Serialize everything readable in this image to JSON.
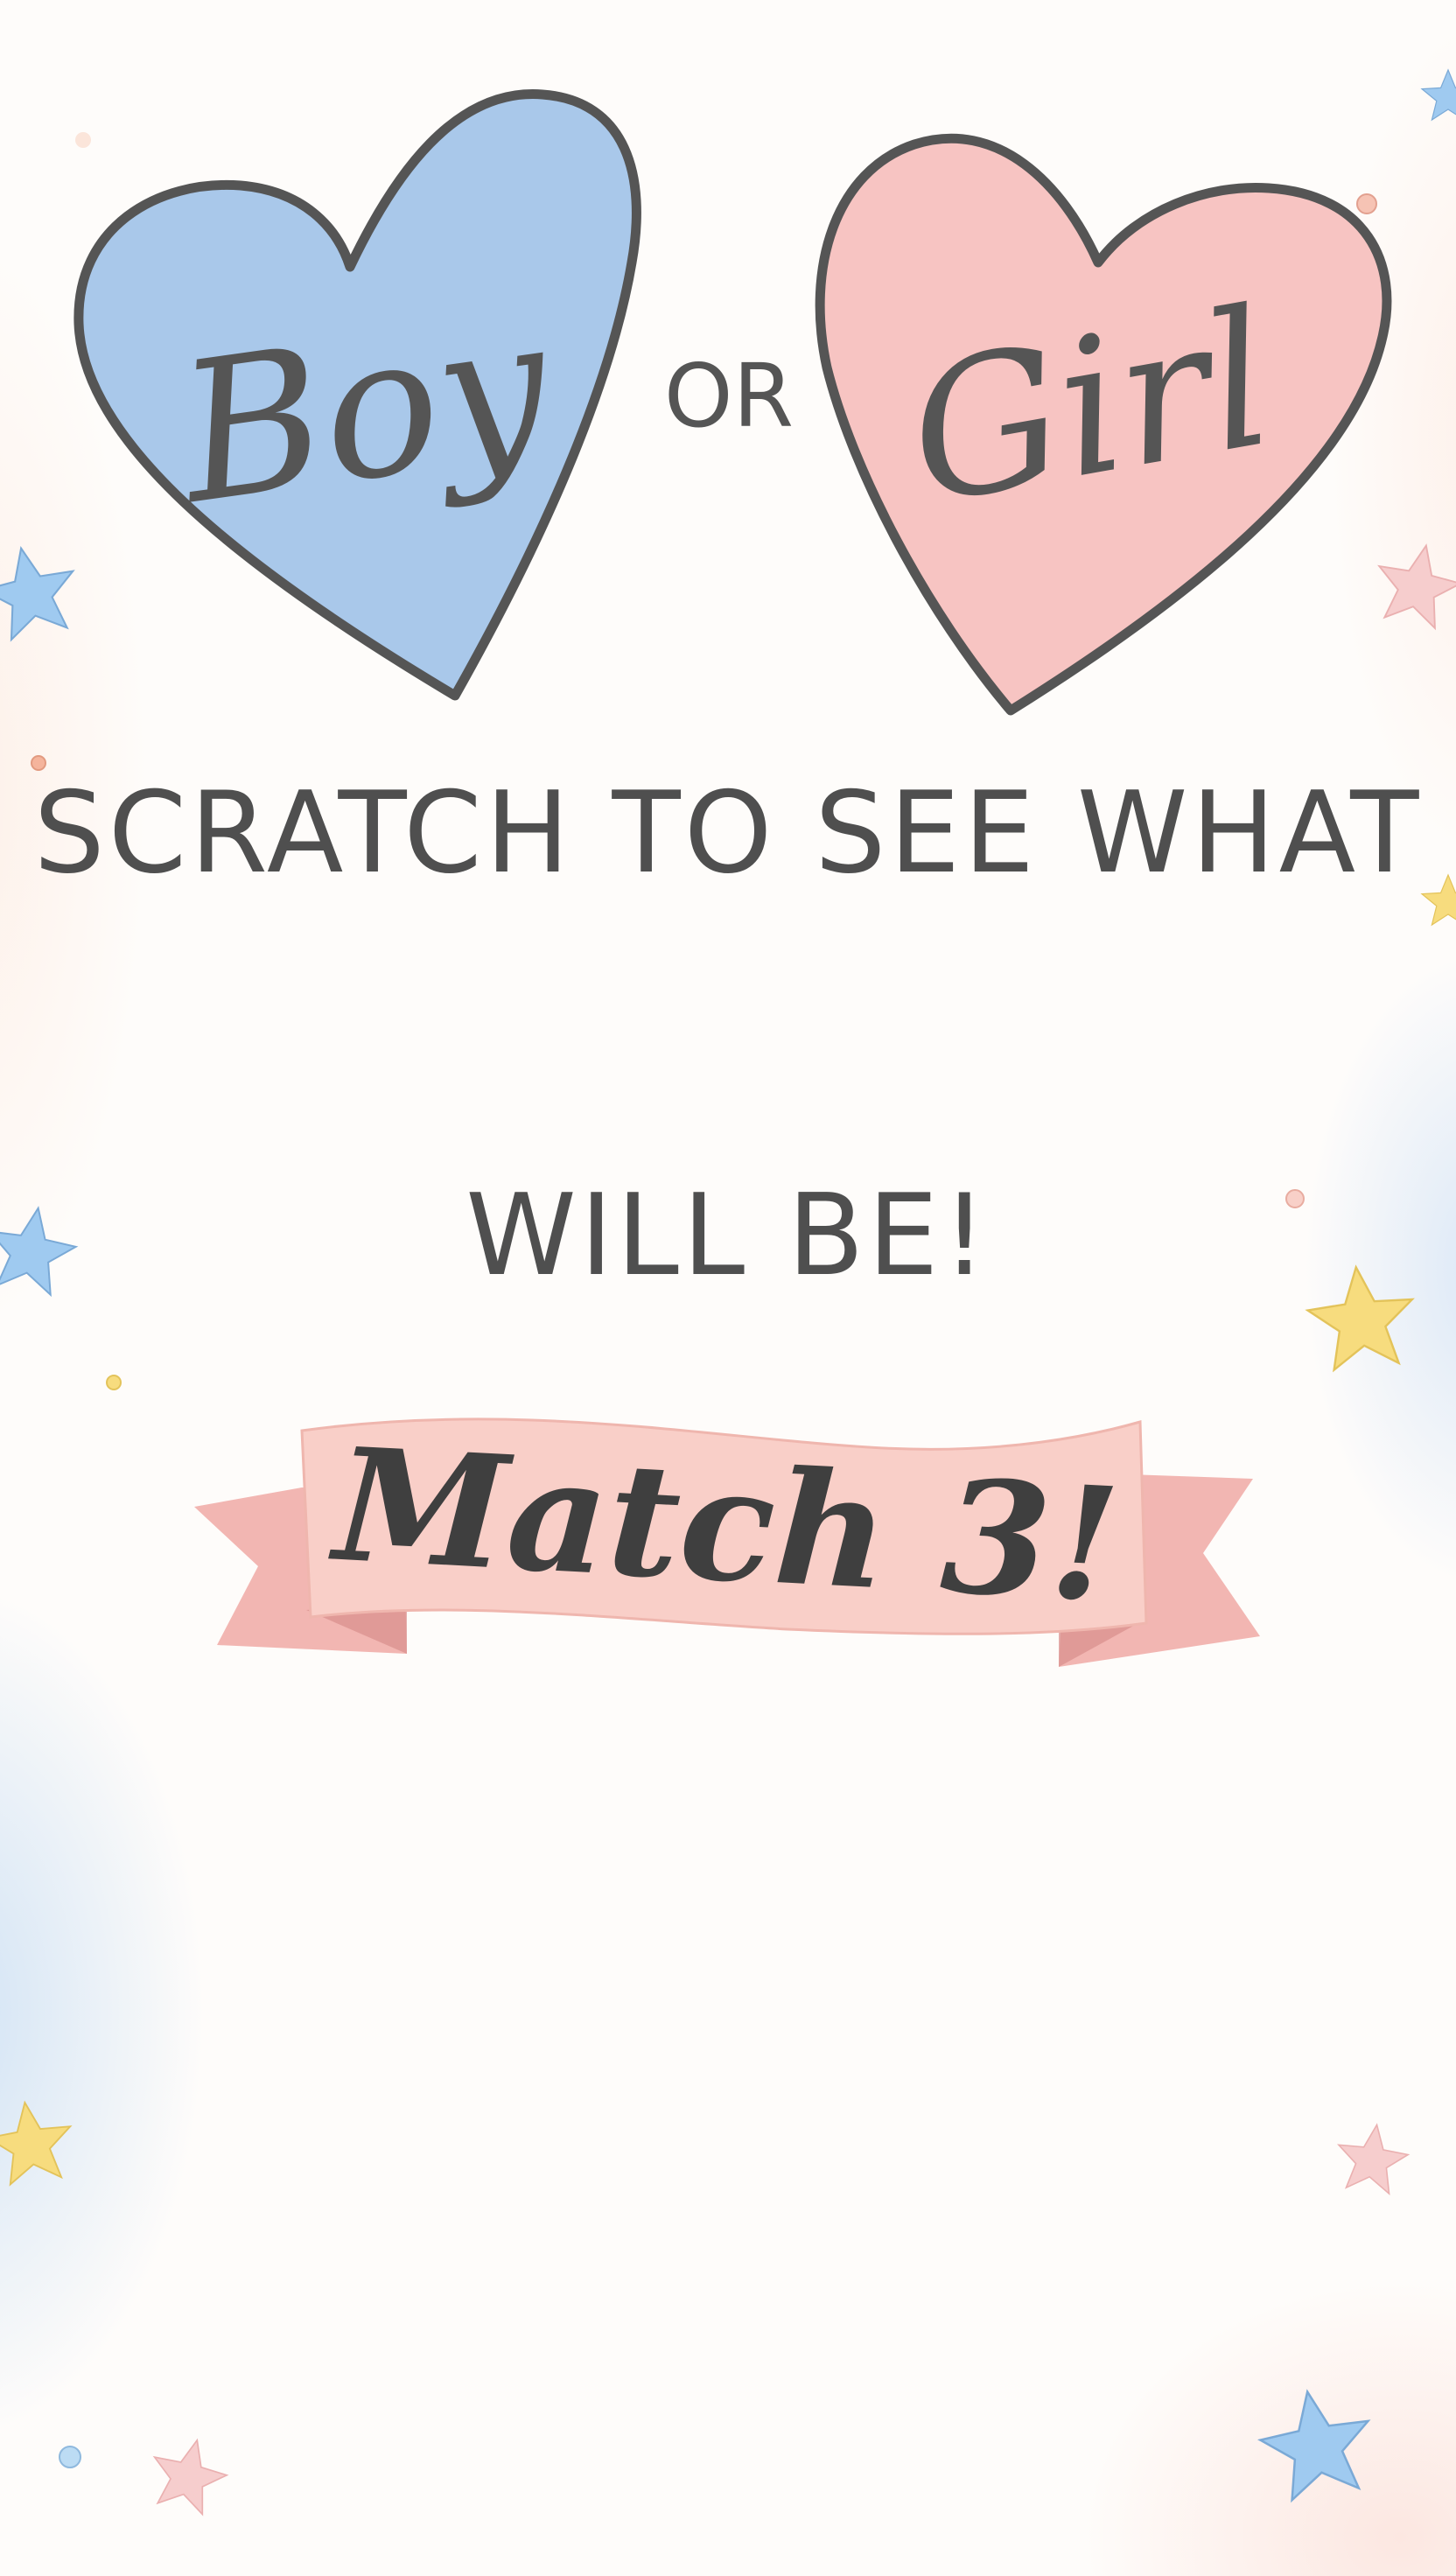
{
  "hearts": {
    "left_label": "Boy",
    "right_label": "Girl",
    "connector": "OR",
    "left_color": "#a9c8ea",
    "right_color": "#f7c4c2",
    "outline_color": "#555555"
  },
  "headline": {
    "line1": "SCRATCH TO SEE WHAT",
    "line2": "WILL BE!"
  },
  "banner": {
    "text": "Match 3!",
    "color": "#f9cfc8",
    "fold_color": "#f1aeaa"
  },
  "decorations": {
    "star_colors": [
      "#9fcaf0",
      "#f7dc7e",
      "#f6cdcd"
    ],
    "icon": "star-icon"
  }
}
